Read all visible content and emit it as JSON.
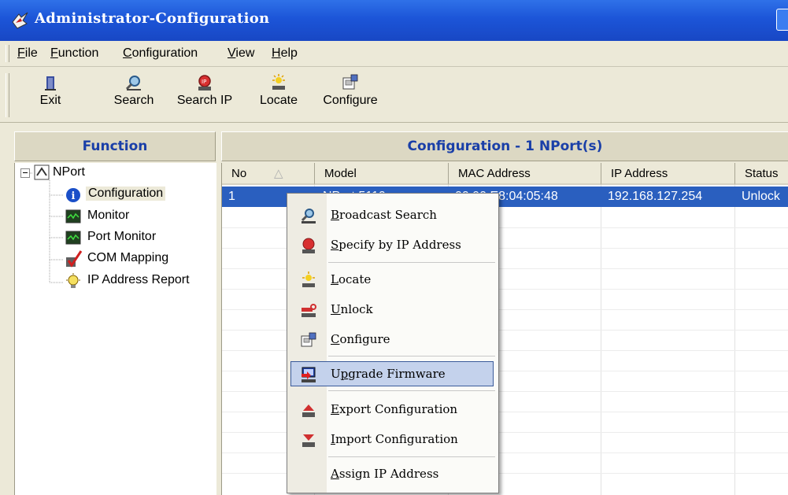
{
  "window": {
    "title": "Administrator-Configuration"
  },
  "menu": {
    "file": "File",
    "function": "Function",
    "configuration": "Configuration",
    "view": "View",
    "help": "Help"
  },
  "toolbar": {
    "exit": "Exit",
    "search": "Search",
    "search_ip": "Search IP",
    "locate": "Locate",
    "configure": "Configure"
  },
  "left_panel": {
    "header": "Function",
    "tree": {
      "root": "NPort",
      "items": [
        "Configuration",
        "Monitor",
        "Port Monitor",
        "COM Mapping",
        "IP Address Report"
      ]
    }
  },
  "right_panel": {
    "header": "Configuration - 1 NPort(s)",
    "columns": [
      "No",
      "Model",
      "MAC Address",
      "IP Address",
      "Status"
    ],
    "rows": [
      {
        "no": "1",
        "model": "NPort 5110",
        "mac": "00:90:E8:04:05:48",
        "ip": "192.168.127.254",
        "status": "Unlock"
      }
    ]
  },
  "context_menu": {
    "broadcast_search": "Broadcast Search",
    "specify_by_ip": "Specify by IP Address",
    "locate": "Locate",
    "unlock": "Unlock",
    "configure": "Configure",
    "upgrade_firmware": "Upgrade Firmware",
    "export_config": "Export Configuration",
    "import_config": "Import Configuration",
    "assign_ip": "Assign IP Address"
  },
  "colors": {
    "title_blue": "#1c55d8",
    "selection": "#2a5fbf",
    "panel_header_text": "#1a3fa8"
  }
}
